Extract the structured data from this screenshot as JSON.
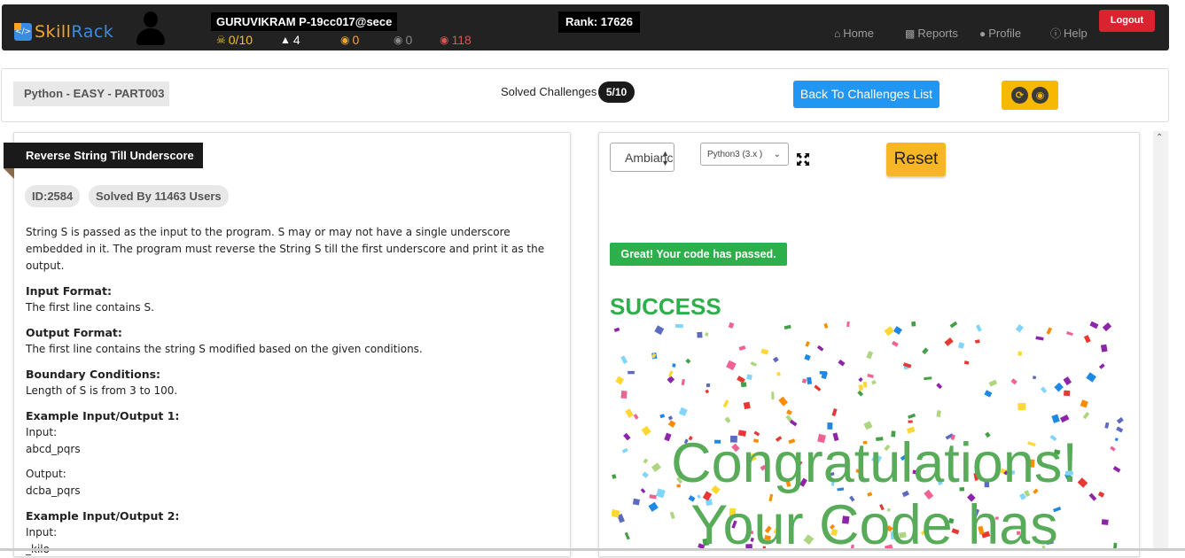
{
  "brand": {
    "name_a": "Skill",
    "name_b": "Rack"
  },
  "user": {
    "name": "GURUVIKRAM P-19cc017@sece"
  },
  "stats": [
    {
      "icon": "trophy-icon",
      "glyph": "🏆",
      "value": "0/10",
      "color": "#f0c419"
    },
    {
      "icon": "graduation-cap-icon",
      "glyph": "🎓",
      "value": "4",
      "color": "#ffffff"
    },
    {
      "icon": "medal-gold-icon",
      "glyph": "🏅",
      "value": "0",
      "color": "#f0a52b"
    },
    {
      "icon": "medal-silver-icon",
      "glyph": "🏅",
      "value": "0",
      "color": "#888888"
    },
    {
      "icon": "medal-red-icon",
      "glyph": "🏅",
      "value": "118",
      "color": "#d9534f"
    }
  ],
  "rank": "Rank: 17626",
  "nav": {
    "home": "Home",
    "reports": "Reports",
    "profile": "Profile",
    "help": "Help",
    "logout": "Logout"
  },
  "topbar": {
    "breadcrumb": "Python - EASY - PART003",
    "solved_label": "Solved Challenges",
    "solved_count": "5/10",
    "back_button": "Back To Challenges List"
  },
  "problem": {
    "title": "Reverse String Till Underscore",
    "id": "ID:2584",
    "solved_by": "Solved By 11463 Users",
    "statement": "String S is passed as the input to the program. S may or may not have a single underscore embedded in it. The program must reverse the String S till the first underscore and print it as the output.",
    "input_format_h": "Input Format:",
    "input_format": "The first line contains S.",
    "output_format_h": "Output Format:",
    "output_format": "The first line contains the string S modified based on the given conditions.",
    "boundary_h": "Boundary Conditions:",
    "boundary": "Length of S is from 3 to 100.",
    "ex1_h": "Example Input/Output 1:",
    "ex1_in_label": "Input:",
    "ex1_in": "abcd_pqrs",
    "ex1_out_label": "Output:",
    "ex1_out": "dcba_pqrs",
    "ex2_h": "Example Input/Output 2:",
    "ex2_in_label": "Input:",
    "ex2_in": "_kilo"
  },
  "editor": {
    "theme_value": "Ambiance",
    "language_value": "Python3 (3.x )",
    "reset": "Reset",
    "passed_message": "Great! Your code has passed.",
    "success": "SUCCESS",
    "congrats_line1": "Congratulations!",
    "congrats_line2": "Your Code has"
  },
  "colors": {
    "accent_blue": "#2196f3",
    "success_green": "#2db04c",
    "warning_yellow": "#f7b626",
    "danger_red": "#d9232f",
    "navbar": "#222222"
  }
}
